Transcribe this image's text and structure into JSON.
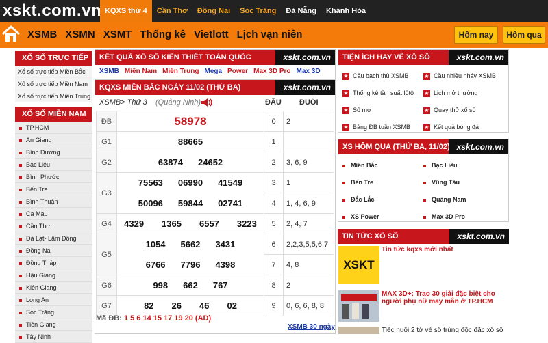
{
  "site": {
    "logo": "xskt.com.vn"
  },
  "top_tabs": [
    {
      "label": "KQXS thứ 4"
    },
    {
      "label": "Cần Thơ"
    },
    {
      "label": "Đồng Nai"
    },
    {
      "label": "Sóc Trăng"
    },
    {
      "label": "Đà Nẵng"
    },
    {
      "label": "Khánh Hòa"
    }
  ],
  "nav": {
    "links": [
      "XSMB",
      "XSMN",
      "XSMT",
      "Thống kê",
      "Vietlott",
      "Lịch vạn niên"
    ],
    "today": "Hôm nay",
    "yesterday": "Hôm qua"
  },
  "sidebar": {
    "live_title": "XỔ SỐ TRỰC TIẾP",
    "live_links": [
      "Xổ số trực tiếp Miền Bắc",
      "Xổ số trực tiếp Miền Nam",
      "Xổ số trực tiếp Miền Trung"
    ],
    "mn_title": "XỔ SỐ MIỀN NAM",
    "provinces": [
      "TP.HCM",
      "An Giang",
      "Bình Dương",
      "Bạc Liêu",
      "Bình Phước",
      "Bến Tre",
      "Bình Thuận",
      "Cà Mau",
      "Cần Thơ",
      "Đà Lạt- Lâm Đồng",
      "Đồng Nai",
      "Đồng Tháp",
      "Hậu Giang",
      "Kiên Giang",
      "Long An",
      "Sóc Trăng",
      "Tiền Giang",
      "Tây Ninh"
    ]
  },
  "kqxs": {
    "title": "KẾT QUẢ XỔ SỐ KIẾN THIẾT TOÀN QUỐC",
    "brand": "xskt.com.vn",
    "regions": [
      {
        "label": "XSMB",
        "color": "#1a3aa8"
      },
      {
        "label": "Miền Nam",
        "color": "#c8161d"
      },
      {
        "label": "Miền Trung",
        "color": "#c8161d"
      },
      {
        "label": "Mega",
        "color": "#1a3aa8"
      },
      {
        "label": "Power",
        "color": "#c8161d"
      },
      {
        "label": "Max 3D Pro",
        "color": "#c8161d"
      },
      {
        "label": "Max 3D",
        "color": "#1a3aa8"
      }
    ]
  },
  "mb": {
    "title": "KQXS MIỀN BẮC NGÀY 11/02 (THỨ BA)",
    "brand": "xskt.com.vn",
    "sub_prefix": "XSMB> Thứ 3",
    "sub_place": "(Quảng Ninh)",
    "col_dau": "ĐẦU",
    "col_duoi": "ĐUÔI",
    "prizes": [
      {
        "label": "ĐB",
        "rows": [
          [
            "58978"
          ]
        ]
      },
      {
        "label": "G1",
        "rows": [
          [
            "88665"
          ]
        ]
      },
      {
        "label": "G2",
        "rows": [
          [
            "63874",
            "24652"
          ]
        ]
      },
      {
        "label": "G3",
        "rows": [
          [
            "75563",
            "06990",
            "41549"
          ],
          [
            "50096",
            "59844",
            "02741"
          ]
        ]
      },
      {
        "label": "G4",
        "rows": [
          [
            "4329",
            "1365",
            "6557",
            "3223"
          ]
        ]
      },
      {
        "label": "G5",
        "rows": [
          [
            "1054",
            "5662",
            "3431"
          ],
          [
            "6766",
            "7796",
            "4398"
          ]
        ]
      },
      {
        "label": "G6",
        "rows": [
          [
            "998",
            "662",
            "767"
          ]
        ]
      },
      {
        "label": "G7",
        "rows": [
          [
            "82",
            "26",
            "46",
            "02"
          ]
        ]
      }
    ],
    "dau_duoi": [
      {
        "dau": "0",
        "duoi": "2"
      },
      {
        "dau": "1",
        "duoi": ""
      },
      {
        "dau": "2",
        "duoi": "3, 6, 9"
      },
      {
        "dau": "3",
        "duoi": "1"
      },
      {
        "dau": "4",
        "duoi": "1, 4, 6, 9"
      },
      {
        "dau": "5",
        "duoi": "2, 4, 7"
      },
      {
        "dau": "6",
        "duoi": "2,2,3,5,5,6,7"
      },
      {
        "dau": "7",
        "duoi": "4, 8"
      },
      {
        "dau": "8",
        "duoi": "2"
      },
      {
        "dau": "9",
        "duoi": "0, 6, 6, 8, 8"
      }
    ],
    "madb_label": "Mã ĐB:",
    "madb_codes": "1 5 6 14 15 17 19 20 (AD)",
    "xsmb30": "XSMB 30 ngày"
  },
  "tienich": {
    "title": "TIỆN ÍCH HAY VỀ XỔ SỐ",
    "brand": "xskt.com.vn",
    "items": [
      "Cầu bạch thủ XSMB",
      "Cầu nhiều nháy XSMB",
      "Thống kê tần suất lôtô",
      "Lịch mở thưởng",
      "Sổ mơ",
      "Quay thử xổ số",
      "Bảng ĐB tuần XSMB",
      "Kết quả bóng đá"
    ]
  },
  "homqua": {
    "title": "XS HÔM QUA (THỨ BA, 11/02)",
    "brand": "xskt.com.vn",
    "items": [
      "Miền Bắc",
      "Bạc Liêu",
      "Bến Tre",
      "Vũng Tàu",
      "Đắc Lắc",
      "Quảng Nam",
      "XS Power",
      "Max 3D Pro"
    ]
  },
  "tintuc": {
    "title": "TIN TỨC XỔ SỐ",
    "brand": "xskt.com.vn",
    "items": [
      {
        "title": "Tin tức kqxs mới nhất",
        "thumb": "XSKT"
      },
      {
        "title": "MAX 3D+: Trao 30 giải đặc biệt cho người phụ nữ may mắn ở TP.HCM"
      },
      {
        "title": "Tiếc nuối 2 tờ vé số trúng độc đắc xổ số"
      }
    ]
  }
}
